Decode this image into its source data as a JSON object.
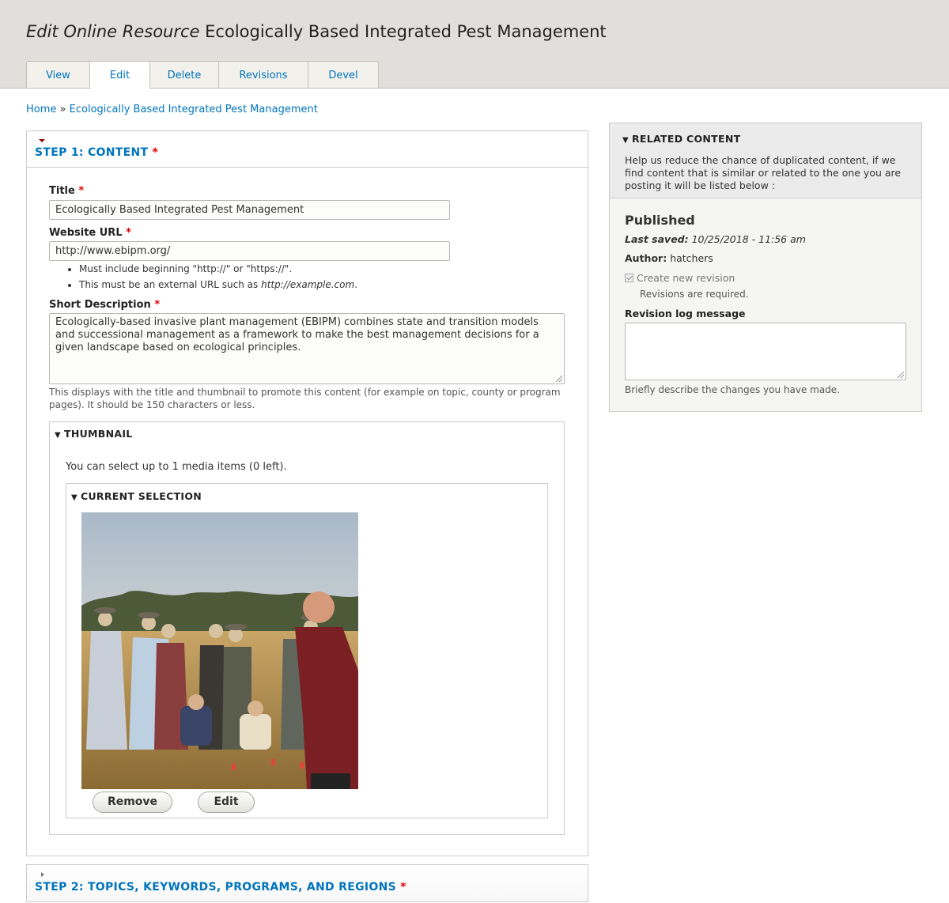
{
  "header": {
    "title_prefix": "Edit Online Resource",
    "title_text": "Ecologically Based Integrated Pest Management",
    "tabs": [
      "View",
      "Edit",
      "Delete",
      "Revisions",
      "Devel"
    ]
  },
  "breadcrumb": {
    "home": "Home",
    "separator": "»",
    "current": "Ecologically Based Integrated Pest Management"
  },
  "step1": {
    "heading": "STEP 1: CONTENT",
    "required_marker": "*",
    "title_label": "Title",
    "title_value": "Ecologically Based Integrated Pest Management",
    "url_label": "Website URL",
    "url_value": "http://www.ebipm.org/",
    "url_help": [
      "Must include beginning \"http://\" or \"https://\".",
      "This must be an external URL such as "
    ],
    "url_help_example": "http://example.com",
    "url_help_period": ".",
    "short_desc_label": "Short Description",
    "short_desc_value": "Ecologically-based invasive plant management (EBIPM)  combines state and transition models and successional management as a framework to make the best management decisions for a given landscape based on ecological principles.",
    "short_desc_help": "This displays with the title and thumbnail to promote this content (for example on topic, county or program pages). It should be 150 characters or less.",
    "thumbnail": {
      "legend": "THUMBNAIL",
      "info": "You can select up to 1 media items (0 left).",
      "selection_legend": "CURRENT SELECTION",
      "remove_label": "Remove",
      "edit_label": "Edit"
    }
  },
  "step2": {
    "heading": "STEP 2: TOPICS, KEYWORDS, PROGRAMS, AND REGIONS",
    "required_marker": "*"
  },
  "sidebar": {
    "related_title": "RELATED CONTENT",
    "related_text": "Help us reduce the chance of duplicated content, if we find content that is similar or related to the one you are posting it will be listed below :",
    "status": "Published",
    "last_saved_label": "Last saved:",
    "last_saved_value": "10/25/2018 - 11:56 am",
    "author_label": "Author:",
    "author_value": "hatchers",
    "new_revision_label": "Create new revision",
    "revisions_required": "Revisions are required.",
    "log_label": "Revision log message",
    "log_value": "",
    "log_help": "Briefly describe the changes you have made."
  },
  "colors": {
    "link": "#0074bd",
    "required": "#e00000",
    "header_bg": "#e0dfdb"
  }
}
